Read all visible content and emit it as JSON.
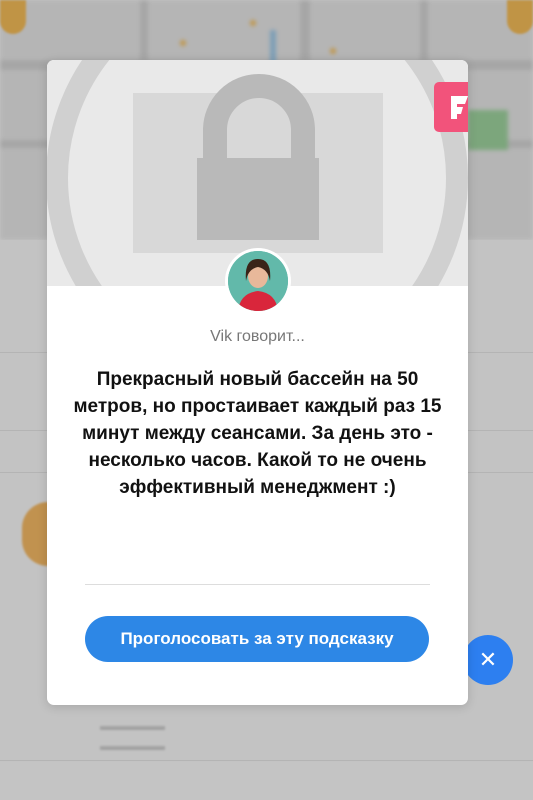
{
  "modal": {
    "speaker": "Vik говорит...",
    "tip_text": "Прекрасный новый бассейн на 50 метров, но простаивает каждый раз 15 минут между сеансами. За день это - несколько часов. Какой то не очень эффективный менеджмент :)",
    "vote_button_label": "Проголосовать за эту подсказку",
    "photo_placeholder_icon": "lock-icon",
    "brand_badge_icon": "foursquare-logo",
    "brand_color": "#f2537b",
    "button_color": "#2d87e6"
  },
  "background": {
    "close_fab_icon": "close-icon"
  }
}
